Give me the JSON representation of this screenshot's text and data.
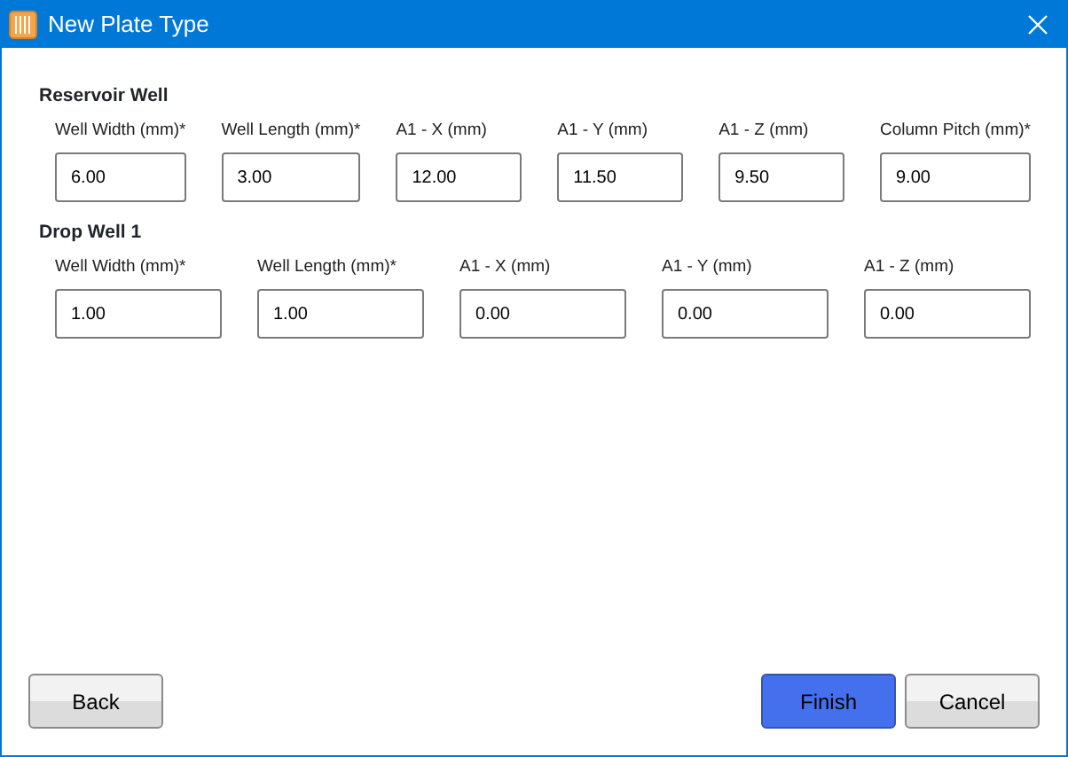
{
  "window": {
    "title": "New Plate Type"
  },
  "sections": [
    {
      "title": "Reservoir Well",
      "fields": [
        {
          "label": "Well Width (mm)*",
          "value": "6.00"
        },
        {
          "label": "Well Length (mm)*",
          "value": "3.00"
        },
        {
          "label": "A1 - X (mm)",
          "value": "12.00"
        },
        {
          "label": "A1 - Y (mm)",
          "value": "11.50"
        },
        {
          "label": "A1 - Z (mm)",
          "value": "9.50"
        },
        {
          "label": "Column Pitch (mm)*",
          "value": "9.00"
        }
      ]
    },
    {
      "title": "Drop Well 1",
      "fields": [
        {
          "label": "Well Width (mm)*",
          "value": "1.00"
        },
        {
          "label": "Well Length (mm)*",
          "value": "1.00"
        },
        {
          "label": "A1 - X (mm)",
          "value": "0.00"
        },
        {
          "label": "A1 - Y (mm)",
          "value": "0.00"
        },
        {
          "label": "A1 - Z (mm)",
          "value": "0.00"
        }
      ]
    }
  ],
  "buttons": [
    {
      "label": "Back",
      "default": false
    },
    {
      "label": "Finish",
      "default": true
    },
    {
      "label": "Cancel",
      "default": false
    }
  ]
}
